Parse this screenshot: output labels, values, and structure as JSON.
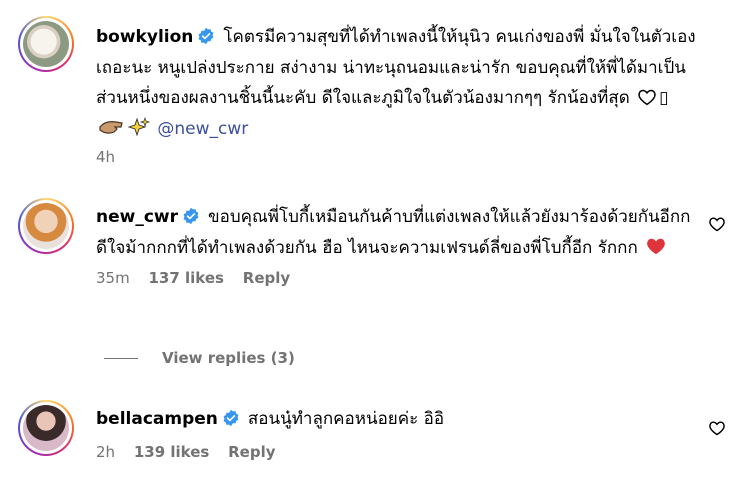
{
  "comments": [
    {
      "username": "bowkylion",
      "text": "โคตรมีความสุขที่ได้ทำเพลงนี้ให้นุนิว คนเก่งของพี่ มั่นใจในตัวเองเถอะนะ หนูเปล่งประกาย สง่างาม น่าทะนุถนอมและน่ารัก ขอบคุณที่ให้พี่ได้มาเป็นส่วนหนึ่งของผลงานชิ้นนี้นะคับ ดีใจและภูมิใจในตัวน้องมากๆๆ รักน้องที่สุด",
      "emoji_names": [
        "white-heart-icon",
        "missing-glyph",
        "hand-icon",
        "sparkles-icon"
      ],
      "missing_glyph": "▯",
      "mention": "@new_cwr",
      "time": "4h"
    },
    {
      "username": "new_cwr",
      "text": "ขอบคุณพี่โบกี้เหมือนกันค้าบที่แต่งเพลงให้แล้วยังมาร้องด้วยกันอีกก ดีใจม้ากกกที่ได้ทำเพลงด้วยกัน ฮือ ไหนจะความเฟรนด์ลี่ของพี่โบกี้อีก รักกก",
      "emoji_names": [
        "red-heart-icon"
      ],
      "time": "35m",
      "likes": "137 likes",
      "reply_label": "Reply",
      "view_replies": "View replies (3)"
    },
    {
      "username": "bellacampen",
      "text": "สอนนู๋ทำลูกคอหน่อยค่ะ อิอิ",
      "time": "2h",
      "likes": "139 likes",
      "reply_label": "Reply"
    }
  ],
  "colors": {
    "verified": "#3797F0",
    "mention": "#3B4F9C",
    "meta": "#737373",
    "heart_red": "#E0343C"
  }
}
